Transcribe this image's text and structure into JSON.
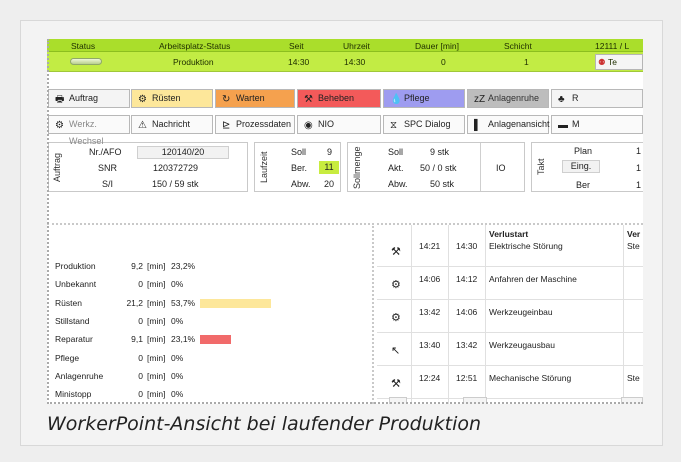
{
  "caption": "WorkerPoint-Ansicht bei laufender Produktion",
  "header": {
    "cols": [
      "Status",
      "Arbeitsplatz-Status",
      "Seit",
      "Uhrzeit",
      "Dauer [min]",
      "Schicht",
      "12111 / L"
    ],
    "values": {
      "arbeitsplatz": "Produktion",
      "seit": "14:30",
      "uhrzeit": "14:30",
      "dauer": "0",
      "schicht": "1",
      "team": "Te"
    }
  },
  "toolbar1": [
    {
      "label": "Auftrag",
      "icon": "🖶",
      "bg": "#f4f4f4",
      "color": "#222"
    },
    {
      "label": "Rüsten",
      "icon": "⚙",
      "bg": "#fde79a",
      "color": "#222"
    },
    {
      "label": "Warten",
      "icon": "↻",
      "bg": "#f5a14e",
      "color": "#222"
    },
    {
      "label": "Beheben",
      "icon": "⚒",
      "bg": "#f35a5a",
      "color": "#222"
    },
    {
      "label": "Pflege",
      "icon": "💧",
      "bg": "#9e9cf0",
      "color": "#222"
    },
    {
      "label": "Anlagenruhe",
      "icon": "zZ",
      "bg": "#bdbdbd",
      "color": "#333"
    },
    {
      "label": "R",
      "icon": "♣",
      "bg": "#f4f4f4",
      "color": "#222"
    }
  ],
  "toolbar2": [
    {
      "label": "Werkz. Wechsel",
      "icon": "⚙",
      "color": "#888"
    },
    {
      "label": "Nachricht",
      "icon": "⚠",
      "color": "#222"
    },
    {
      "label": "Prozessdaten",
      "icon": "⊵",
      "color": "#222"
    },
    {
      "label": "NIO",
      "icon": "◉",
      "color": "#222"
    },
    {
      "label": "SPC Dialog",
      "icon": "⧖",
      "color": "#222"
    },
    {
      "label": "Anlagenansicht",
      "icon": "▌",
      "color": "#222"
    },
    {
      "label": "M",
      "icon": "▬",
      "color": "#222"
    }
  ],
  "auftrag": {
    "title": "Auftrag",
    "rows": [
      {
        "k": "Nr./AFO",
        "v": "120140/20"
      },
      {
        "k": "SNR",
        "v": "120372729"
      },
      {
        "k": "S/I",
        "v": "150 / 59 stk"
      }
    ]
  },
  "laufzeit": {
    "title": "Laufzeit",
    "rows": [
      {
        "k": "Soll",
        "v": "9"
      },
      {
        "k": "Ber.",
        "v": "11"
      },
      {
        "k": "Abw.",
        "v": "20"
      }
    ]
  },
  "sollmenge": {
    "title": "Sollmenge",
    "rows": [
      {
        "k": "Soll",
        "v": "9 stk"
      },
      {
        "k": "Akt.",
        "v": "50 / 0 stk"
      },
      {
        "k": "Abw.",
        "v": "50 stk"
      }
    ],
    "io": "IO"
  },
  "takt": {
    "title": "Takt",
    "plan": "Plan",
    "eing": "Eing.",
    "ber": "Ber",
    "right1": "1",
    "right2": "1",
    "right3": "1"
  },
  "stats": [
    {
      "name": "Produktion",
      "val": "9,2",
      "unit": "[min]",
      "pct": "23,2%",
      "bar": 0,
      "color": ""
    },
    {
      "name": "Unbekannt",
      "val": "0",
      "unit": "[min]",
      "pct": "0%",
      "bar": 0,
      "color": ""
    },
    {
      "name": "Rüsten",
      "val": "21,2",
      "unit": "[min]",
      "pct": "53,7%",
      "bar": 0.537,
      "color": "#fde79a"
    },
    {
      "name": "Stillstand",
      "val": "0",
      "unit": "[min]",
      "pct": "0%",
      "bar": 0,
      "color": ""
    },
    {
      "name": "Reparatur",
      "val": "9,1",
      "unit": "[min]",
      "pct": "23,1%",
      "bar": 0.231,
      "color": "#f16a6a"
    },
    {
      "name": "Pflege",
      "val": "0",
      "unit": "[min]",
      "pct": "0%",
      "bar": 0,
      "color": ""
    },
    {
      "name": "Anlagenruhe",
      "val": "0",
      "unit": "[min]",
      "pct": "0%",
      "bar": 0,
      "color": ""
    },
    {
      "name": "Ministopp",
      "val": "0",
      "unit": "[min]",
      "pct": "0%",
      "bar": 0,
      "color": ""
    }
  ],
  "verlust": {
    "header": "Verlustart",
    "header2": "Ver",
    "rows": [
      {
        "icon": "⚒",
        "from": "14:21",
        "to": "14:30",
        "text": "Elektrische Störung",
        "extra": "Ste"
      },
      {
        "icon": "⚙",
        "from": "14:06",
        "to": "14:12",
        "text": "Anfahren der Maschine",
        "extra": ""
      },
      {
        "icon": "⚙",
        "from": "13:42",
        "to": "14:06",
        "text": "Werkzeugeinbau",
        "extra": ""
      },
      {
        "icon": "↖",
        "from": "13:40",
        "to": "13:42",
        "text": "Werkzeugausbau",
        "extra": ""
      },
      {
        "icon": "⚒",
        "from": "12:24",
        "to": "12:51",
        "text": "Mechanische Störung",
        "extra": "Ste"
      }
    ]
  }
}
